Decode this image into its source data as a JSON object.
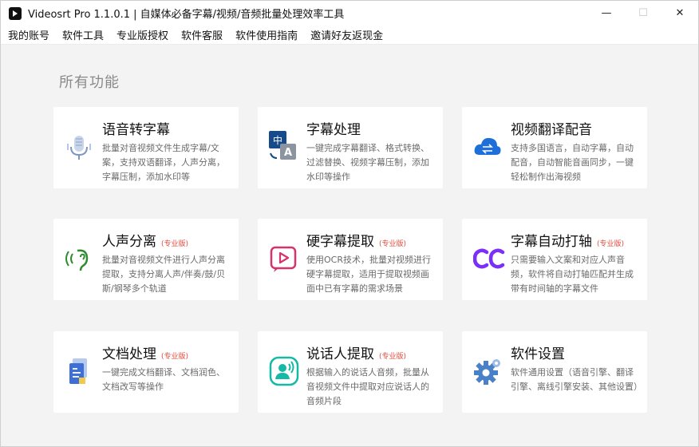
{
  "window": {
    "title": "Videosrt Pro 1.1.0.1  |  自媒体必备字幕/视频/音频批量处理效率工具",
    "minimize_glyph": "—",
    "maximize_glyph": "☐",
    "close_glyph": "✕"
  },
  "menu": {
    "items": [
      {
        "label": "我的账号"
      },
      {
        "label": "软件工具"
      },
      {
        "label": "专业版授权"
      },
      {
        "label": "软件客服"
      },
      {
        "label": "软件使用指南"
      },
      {
        "label": "邀请好友返现金"
      }
    ]
  },
  "main": {
    "section_title": "所有功能",
    "cards": [
      {
        "title": "语音转字幕",
        "badge": "",
        "icon": "microphone-icon",
        "desc": "批量对音视频文件生成字幕/文案，支持双语翻译，人声分离，字幕压制，添加水印等"
      },
      {
        "title": "字幕处理",
        "badge": "",
        "icon": "translate-icon",
        "desc": "一键完成字幕翻译、格式转换、过滤替换、视频字幕压制，添加水印等操作"
      },
      {
        "title": "视频翻译配音",
        "badge": "",
        "icon": "cloud-sync-icon",
        "desc": "支持多国语言，自动字幕，自动配音，自动智能音画同步，一键轻松制作出海视频"
      },
      {
        "title": "人声分离",
        "badge": "(专业版)",
        "icon": "ear-sound-icon",
        "desc": "批量对音视频文件进行人声分离提取，支持分离人声/伴奏/鼓/贝斯/钢琴多个轨道"
      },
      {
        "title": "硬字幕提取",
        "badge": "(专业版)",
        "icon": "video-play-icon",
        "desc": "使用OCR技术，批量对视频进行硬字幕提取，适用于提取视频画面中已有字幕的需求场景"
      },
      {
        "title": "字幕自动打轴",
        "badge": "(专业版)",
        "icon": "cc-icon",
        "desc": "只需要输入文案和对应人声音频，软件将自动打轴匹配并生成带有时间轴的字幕文件"
      },
      {
        "title": "文档处理",
        "badge": "(专业版)",
        "icon": "document-icon",
        "desc": "一键完成文档翻译、文档润色、文档改写等操作"
      },
      {
        "title": "说话人提取",
        "badge": "(专业版)",
        "icon": "speaker-icon",
        "desc": "根据输入的说话人音频，批量从音视频文件中提取对应说话人的音频片段"
      },
      {
        "title": "软件设置",
        "badge": "",
        "icon": "gear-icon",
        "desc": "软件通用设置（语音引擎、翻译引擎、离线引擎安装、其他设置）"
      }
    ]
  },
  "colors": {
    "accent_blue": "#1e6fd9",
    "badge_red": "#e54b3c",
    "cc_purple": "#7b2ff7",
    "speaker_teal": "#16b8a6",
    "ear_green": "#2e8b2e",
    "video_pink": "#d6336c",
    "gear_blue": "#4a80c8"
  }
}
